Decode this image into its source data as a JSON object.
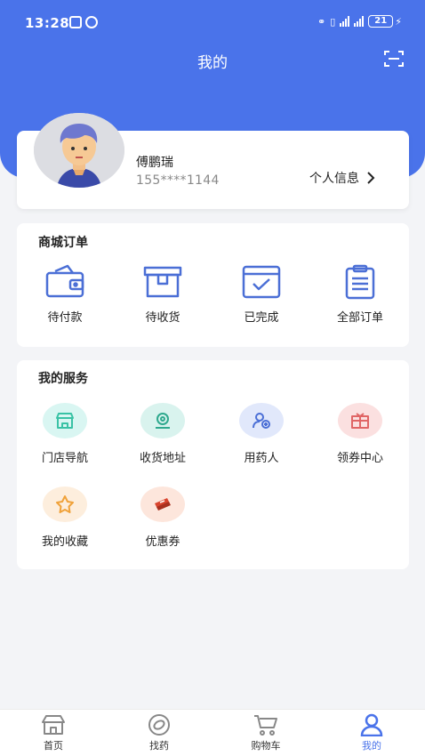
{
  "status_bar": {
    "time": "13:28",
    "battery": "21"
  },
  "header": {
    "title": "我的"
  },
  "profile": {
    "name": "傅鹏瑞",
    "phone": "155****1144",
    "info_link": "个人信息"
  },
  "orders": {
    "title": "商城订单",
    "items": [
      {
        "label": "待付款",
        "icon": "wallet-icon"
      },
      {
        "label": "待收货",
        "icon": "box-icon"
      },
      {
        "label": "已完成",
        "icon": "check-calendar-icon"
      },
      {
        "label": "全部订单",
        "icon": "clipboard-icon"
      }
    ]
  },
  "services": {
    "title": "我的服务",
    "items": [
      {
        "label": "门店导航",
        "icon": "store-icon"
      },
      {
        "label": "收货地址",
        "icon": "location-icon"
      },
      {
        "label": "用药人",
        "icon": "patient-icon"
      },
      {
        "label": "领券中心",
        "icon": "gift-icon"
      },
      {
        "label": "我的收藏",
        "icon": "star-icon"
      },
      {
        "label": "优惠券",
        "icon": "ticket-icon"
      }
    ]
  },
  "tabbar": {
    "items": [
      {
        "label": "首页",
        "icon": "home-icon"
      },
      {
        "label": "找药",
        "icon": "pill-search-icon"
      },
      {
        "label": "购物车",
        "icon": "cart-icon"
      },
      {
        "label": "我的",
        "icon": "user-icon"
      }
    ],
    "active": "我的"
  },
  "colors": {
    "primary": "#4a73ea",
    "order_icon": "#4b6fd6",
    "background": "#f3f4f7"
  }
}
